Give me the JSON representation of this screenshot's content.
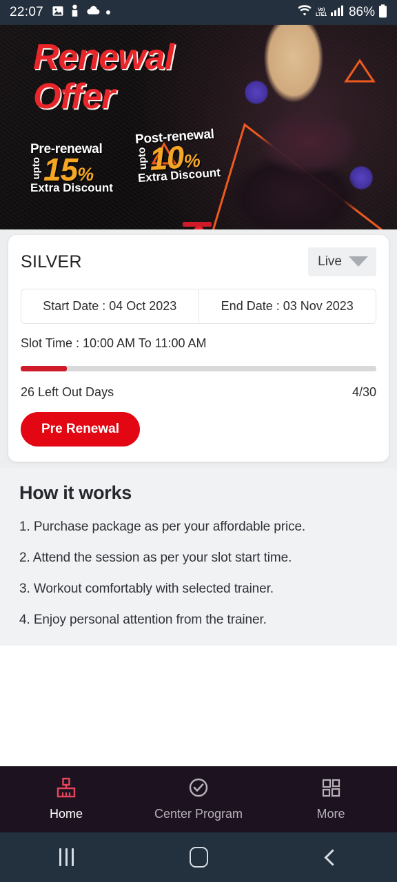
{
  "status_bar": {
    "time": "22:07",
    "left_icons": [
      "image-icon",
      "person-icon",
      "cloud-icon",
      "dot-icon"
    ],
    "volte_top": "Vo)",
    "volte_bottom": "LTE1",
    "battery_percent": "86%",
    "right_icons": [
      "wifi-icon",
      "volte-icon",
      "signal-icon",
      "battery-icon"
    ]
  },
  "banner": {
    "title_line1": "Renewal",
    "title_line2": "Offer",
    "pre": {
      "label": "Pre-renewal",
      "upto": "upto",
      "percent": "15",
      "percent_symbol": "%",
      "sub": "Extra Discount"
    },
    "post": {
      "label": "Post-renewal",
      "upto": "upto",
      "percent": "10",
      "percent_symbol": "%",
      "sub": "Extra Discount"
    },
    "accent_red": "#e8252a",
    "accent_yellow": "#f5a623",
    "accent_orange": "#ef5a1f"
  },
  "package_card": {
    "tier": "SILVER",
    "status_label": "Live",
    "start_date": "Start Date : 04 Oct 2023",
    "end_date": "End Date : 03 Nov 2023",
    "slot_time": "Slot Time : 10:00 AM To 11:00 AM",
    "left_days": "26 Left Out Days",
    "progress_text": "4/30",
    "progress_percent": 13,
    "cta_label": "Pre Renewal",
    "cta_color": "#e30613"
  },
  "how_it_works": {
    "heading": "How it works",
    "steps": [
      "1. Purchase package as per your affordable price.",
      "2. Attend the session as per your slot start time.",
      "3. Workout comfortably with selected trainer.",
      "4. Enjoy personal attention from the trainer."
    ]
  },
  "bottom_nav": {
    "items": [
      {
        "label": "Home",
        "icon": "home-gym-icon",
        "active": true
      },
      {
        "label": "Center Program",
        "icon": "check-circle-icon",
        "active": false
      },
      {
        "label": "More",
        "icon": "grid-icon",
        "active": false
      }
    ],
    "active_color": "#e8455c",
    "inactive_color": "#b6b2b8"
  },
  "android_nav": {
    "recents": "recents-icon",
    "home": "home-icon",
    "back": "back-icon"
  }
}
